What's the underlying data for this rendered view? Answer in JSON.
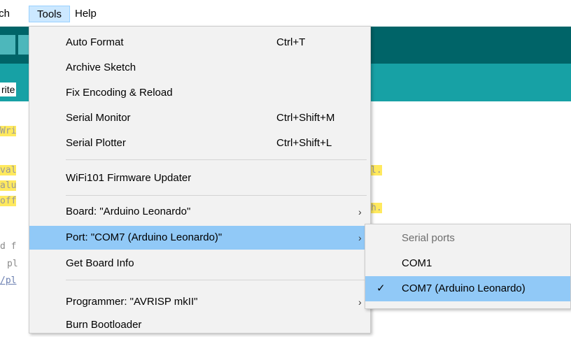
{
  "menubar": {
    "items": [
      "tch",
      "Tools",
      "Help"
    ]
  },
  "tab": {
    "label": "rite"
  },
  "editor_fragments": [
    "Wri",
    "val",
    "alu",
    "off",
    "l.",
    "h.",
    "d f",
    "pl",
    "/pl"
  ],
  "tools_menu": {
    "items": [
      {
        "label": "Auto Format",
        "shortcut": "Ctrl+T"
      },
      {
        "label": "Archive Sketch",
        "shortcut": ""
      },
      {
        "label": "Fix Encoding & Reload",
        "shortcut": ""
      },
      {
        "label": "Serial Monitor",
        "shortcut": "Ctrl+Shift+M"
      },
      {
        "label": "Serial Plotter",
        "shortcut": "Ctrl+Shift+L"
      },
      {
        "label": "WiFi101 Firmware Updater",
        "shortcut": ""
      },
      {
        "label": "Board: \"Arduino Leonardo\"",
        "shortcut": ""
      },
      {
        "label": "Port: \"COM7 (Arduino Leonardo)\"",
        "shortcut": ""
      },
      {
        "label": "Get Board Info",
        "shortcut": ""
      },
      {
        "label": "Programmer: \"AVRISP mkII\"",
        "shortcut": ""
      },
      {
        "label": "Burn Bootloader",
        "shortcut": ""
      }
    ],
    "submenu_arrow": "›"
  },
  "port_submenu": {
    "header": "Serial ports",
    "items": [
      {
        "label": "COM1",
        "selected": false
      },
      {
        "label": "COM7 (Arduino Leonardo)",
        "selected": true
      }
    ],
    "check": "✓"
  },
  "colors": {
    "toolbar_dark": "#006468",
    "toolbar_tabs": "#17a1a5",
    "menu_bg": "#f2f2f2",
    "highlight": "#91c9f7",
    "code_highlight": "#ffe95e"
  }
}
